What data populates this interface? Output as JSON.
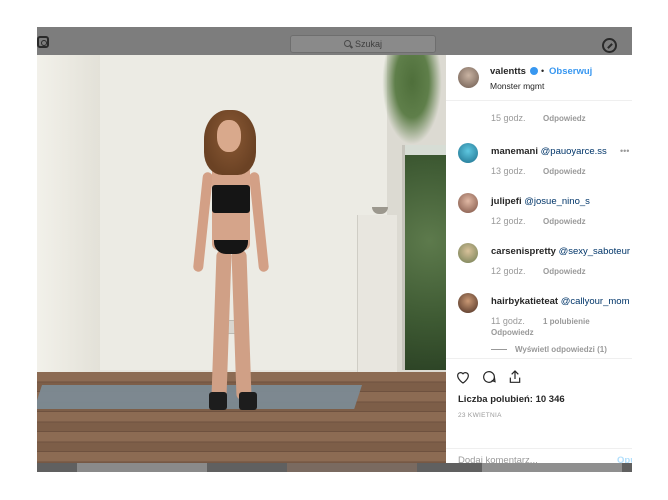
{
  "search": {
    "placeholder": "Szukaj"
  },
  "post": {
    "username": "valentts",
    "follow_label": "Obserwuj",
    "location": "Monster mgmt",
    "likes_label": "Liczba polubień: 10 346",
    "date": "23 KWIETNIA",
    "add_comment_placeholder": "Dodaj komentarz...",
    "post_label": "Opu"
  },
  "comments": [
    {
      "user": "",
      "mention": "",
      "time": "15 godz.",
      "reply": "Odpowiedz"
    },
    {
      "user": "manemani",
      "mention": "@pauoyarce.ss",
      "time": "13 godz.",
      "reply": "Odpowiedz"
    },
    {
      "user": "julipefi",
      "mention": "@josue_nino_s",
      "time": "12 godz.",
      "reply": "Odpowiedz"
    },
    {
      "user": "carsenispretty",
      "mention": "@sexy_saboteur",
      "time": "12 godz.",
      "reply": "Odpowiedz"
    },
    {
      "user": "hairbykatieteat",
      "mention": "@callyour_mom",
      "time": "11 godz.",
      "likes": "1 polubienie",
      "reply": "Odpowiedz"
    }
  ],
  "view_replies": "Wyświetl odpowiedzi (1)",
  "colors": {
    "accent": "#3897f0",
    "overlay": "#7f7f7f"
  }
}
